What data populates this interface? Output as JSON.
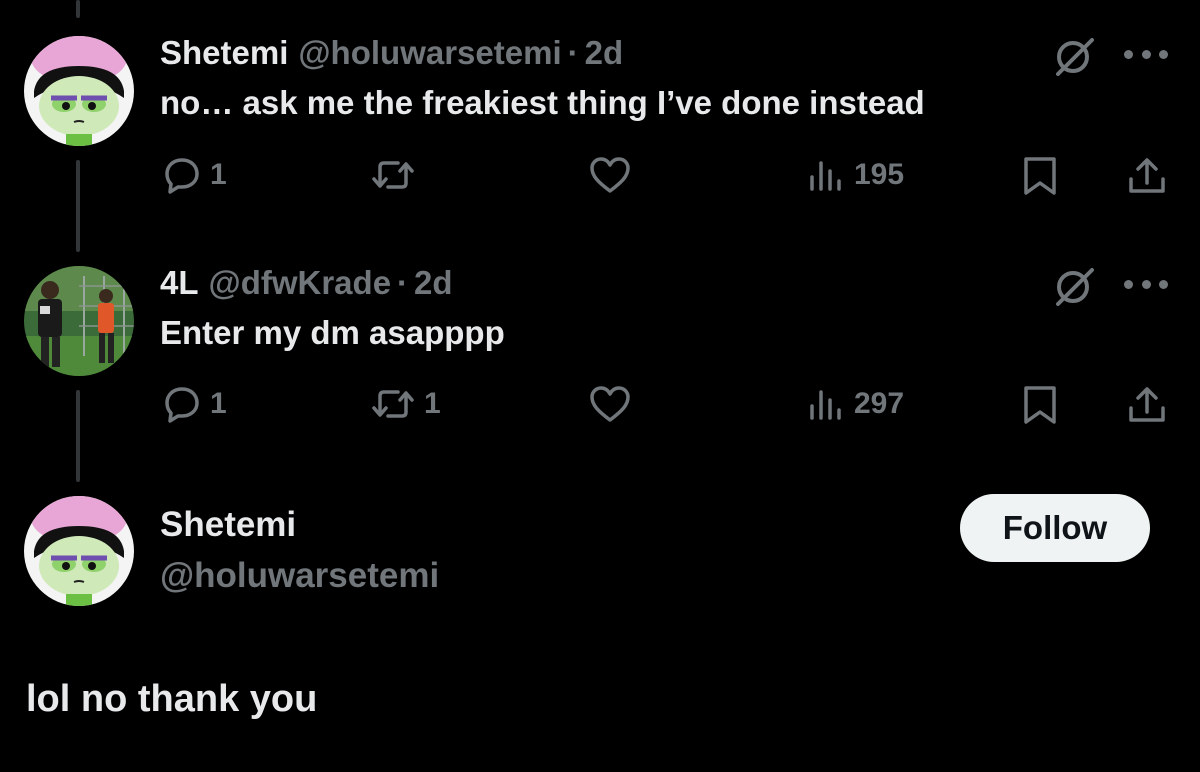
{
  "tweets": [
    {
      "name": "Shetemi",
      "handle": "@holuwarsetemi",
      "separator": "·",
      "time": "2d",
      "text": "no… ask me the freakiest thing I’ve done instead",
      "replies": "1",
      "reposts": "",
      "views": "195",
      "avatar_icon": "cartoon-buttercup-avatar"
    },
    {
      "name": "4L",
      "handle": "@dfwKrade",
      "separator": "·",
      "time": "2d",
      "text": "Enter my dm asapppp",
      "replies": "1",
      "reposts": "1",
      "views": "297",
      "avatar_icon": "photo-avatar"
    }
  ],
  "main_post": {
    "name": "Shetemi",
    "handle": "@holuwarsetemi",
    "follow_label": "Follow",
    "text": "lol no thank you",
    "avatar_icon": "cartoon-buttercup-avatar"
  },
  "icons": {
    "reply": "reply-icon",
    "repost": "repost-icon",
    "like": "heart-icon",
    "views": "views-icon",
    "bookmark": "bookmark-icon",
    "share": "share-icon",
    "grok": "grok-icon",
    "more": "more-icon"
  },
  "colors": {
    "background": "#000000",
    "text": "#e7e9ea",
    "muted": "#71767b",
    "thread_line": "#333639",
    "follow_bg": "#eff3f4",
    "follow_text": "#0f1419"
  }
}
